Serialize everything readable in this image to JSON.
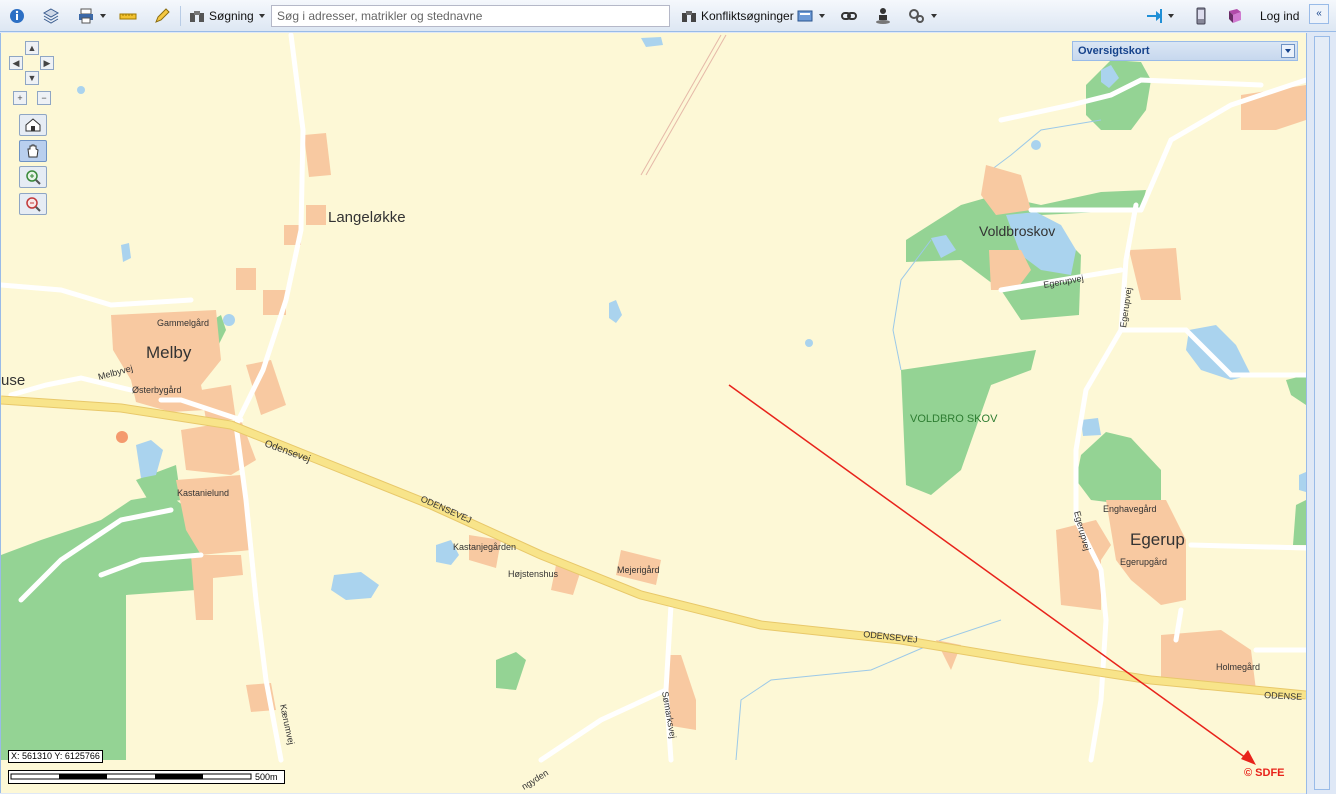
{
  "toolbar": {
    "info_icon": "info-icon",
    "layers_icon": "layers-icon",
    "print_icon": "printer-icon",
    "measure_icon": "ruler-icon",
    "draw_icon": "pencil-icon",
    "search_label": "Søgning",
    "search_placeholder": "Søg i adresser, matrikler og stednavne",
    "conflict_label": "Konfliktsøgninger",
    "login_label": "Log ind"
  },
  "overview": {
    "title": "Oversigtskort"
  },
  "map": {
    "places": {
      "langeloekke": "Langeløkke",
      "melby": "Melby",
      "use": "use",
      "voldbroskov": "Voldbroskov",
      "voldbro_skov": "VOLDBRO SKOV",
      "egerup": "Egerup"
    },
    "farms": {
      "gammelgaard": "Gammelgård",
      "oesterbygaard": "Østerbygård",
      "kastanielund": "Kastanielund",
      "kastanjegaarden": "Kastanjegården",
      "hoejstenshus": "Højstenshus",
      "mejerigaard": "Mejerigård",
      "enghavegaard": "Enghavegård",
      "egerupgaard": "Egerupgård",
      "holmegaard": "Holmegård"
    },
    "roads": {
      "odensevej": "Odensevej",
      "odensevej_caps": "ODENSEVEJ",
      "odensevej_caps2": "ODENSEVEJ",
      "odense_cut": "ODENSE",
      "melbyvej": "Melbyvej",
      "egerupvej_a": "Egerupvej",
      "egerupvej_b": "Egerupvej",
      "egerupvej_c": "Egerupvej",
      "kaerumvej": "Kærumvej",
      "soemarksvej": "Sømarksvej",
      "engyden": "ngyden"
    }
  },
  "coordinates": "X: 561310 Y: 6125766",
  "scale_label": "500m",
  "copyright": "© SDFE",
  "colors": {
    "map_bg": "#fdf8d6",
    "forest": "#94d394",
    "building": "#f8c9a1",
    "water": "#aad3ee",
    "main_road": "#f8e48a",
    "arrow": "#e8231b"
  }
}
